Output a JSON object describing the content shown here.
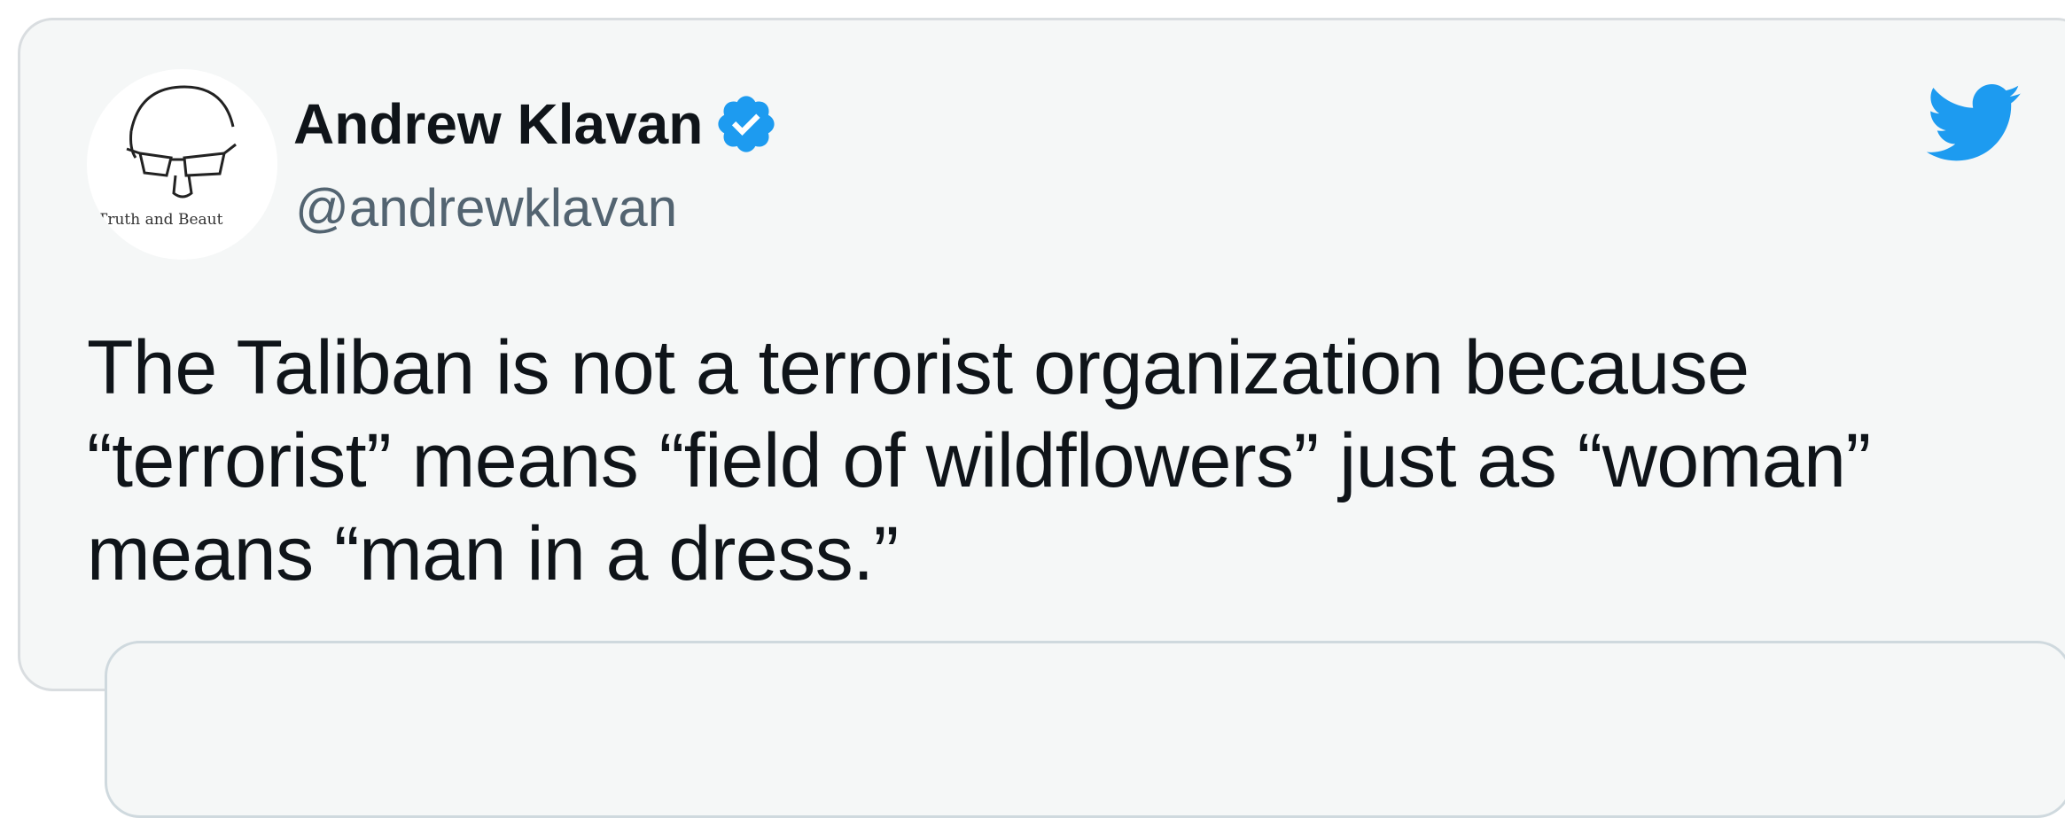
{
  "tweet": {
    "display_name": "Andrew Klavan",
    "handle": "@andrewklavan",
    "verified": true,
    "avatar_caption": "Truth and Beaut",
    "text_lines": [
      "The Taliban is not a terrorist organization because",
      "“terrorist” means “field of wildflowers” just as “woman”",
      "means “man in a dress.”"
    ]
  },
  "icons": {
    "verified": "verified-badge-icon",
    "brand": "twitter-bird-icon",
    "avatar": "face-sketch-avatar"
  },
  "colors": {
    "card_background": "#f5f7f7",
    "border": "#d9dde0",
    "text": "#0f1419",
    "handle": "#536471",
    "twitter_blue": "#1d9bf0"
  }
}
